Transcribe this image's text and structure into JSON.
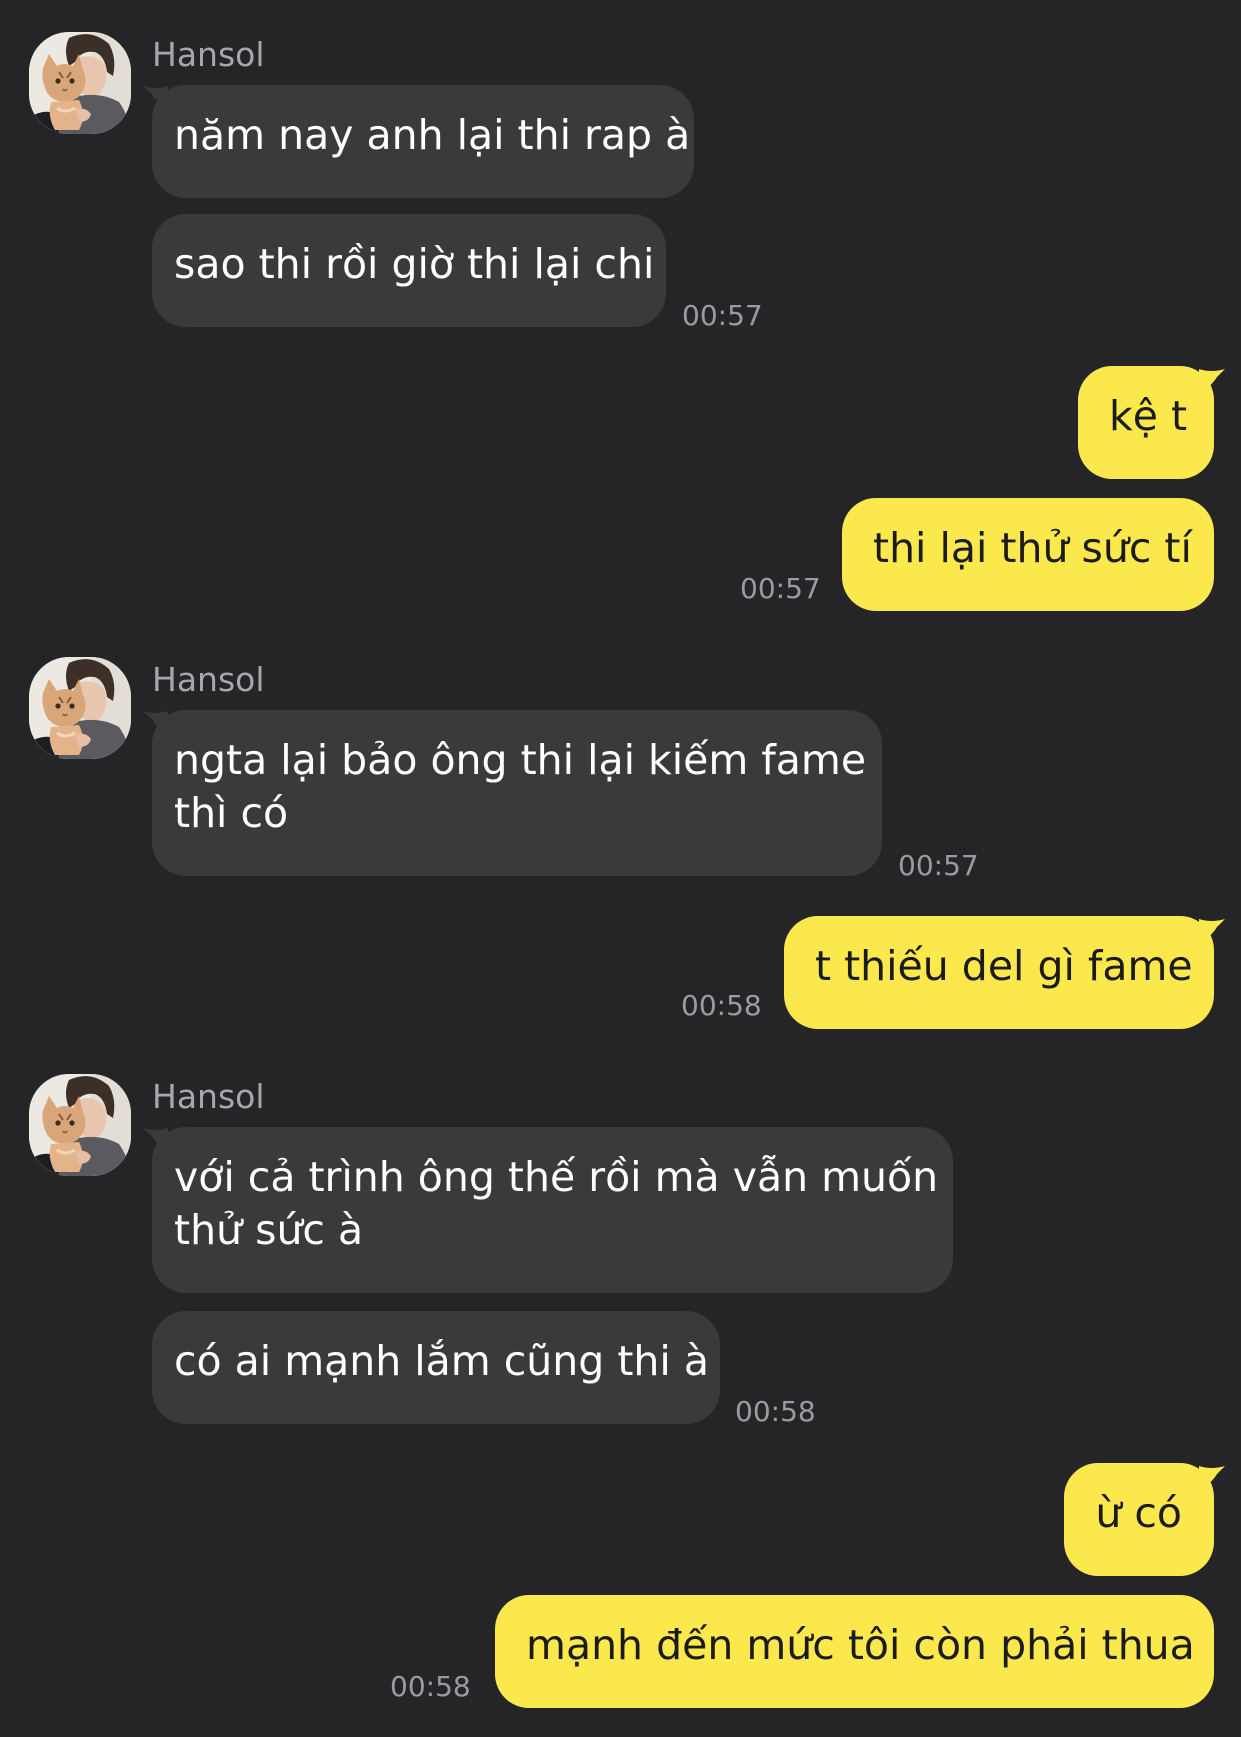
{
  "colors": {
    "background": "#252527",
    "incoming_bubble": "#3a3a3d",
    "outgoing_bubble": "#fae84d",
    "sender_name": "#a7a7ab",
    "timestamp": "#9b9b9f"
  },
  "groups": [
    {
      "sender": "Hansol",
      "messages": [
        "năm nay anh lại thi rap à",
        "sao thi rồi giờ thi lại chi"
      ],
      "time": "00:57"
    },
    {
      "messages": [
        "kệ t",
        "thi lại thử sức tí"
      ],
      "time": "00:57"
    },
    {
      "sender": "Hansol",
      "messages": [
        [
          "ngta lại bảo ông thi lại kiếm fame",
          "thì có"
        ]
      ],
      "time": "00:57"
    },
    {
      "messages": [
        "t thiếu del gì fame"
      ],
      "time": "00:58"
    },
    {
      "sender": "Hansol",
      "messages": [
        [
          "với cả trình ông thế rồi mà vẫn muốn",
          "thử sức à"
        ],
        "có ai mạnh lắm cũng thi à"
      ],
      "time": "00:58"
    },
    {
      "messages": [
        "ừ có",
        "mạnh đến mức tôi còn phải thua"
      ],
      "time": "00:58"
    }
  ]
}
